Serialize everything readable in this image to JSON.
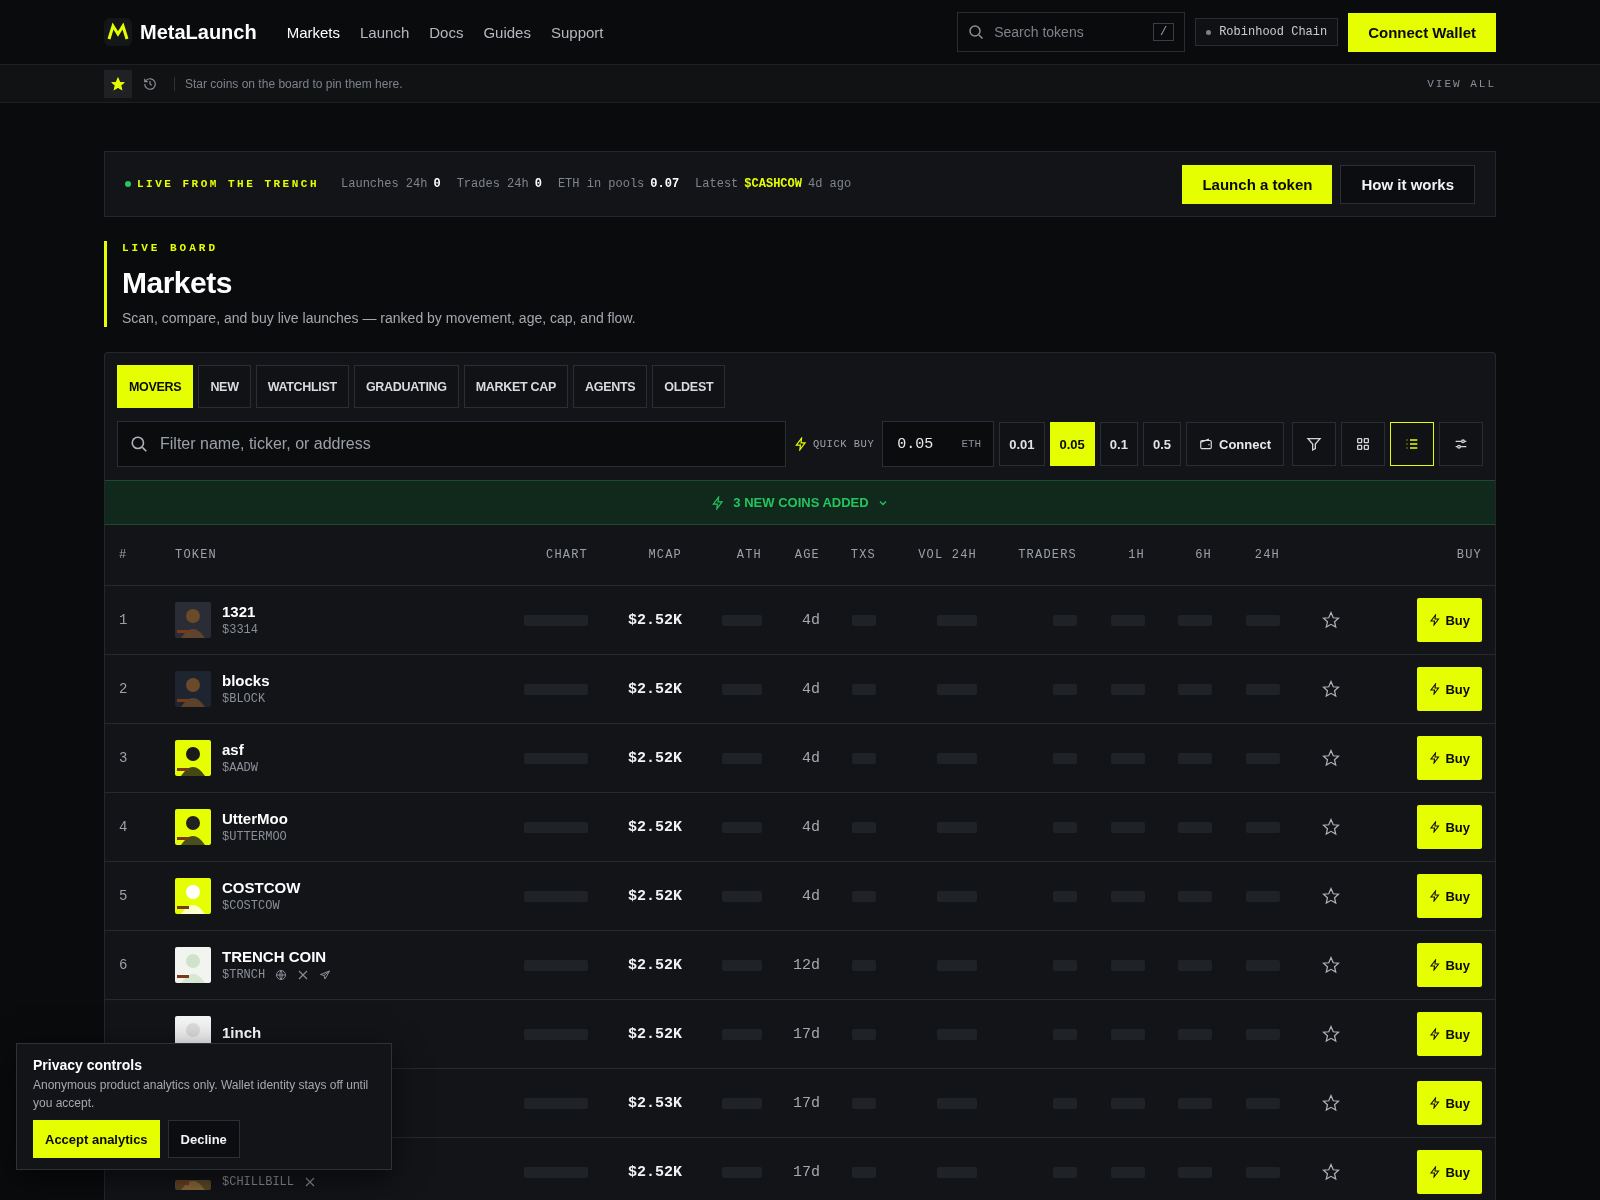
{
  "nav": {
    "brand": "MetaLaunch",
    "links": [
      {
        "label": "Markets",
        "selected": true
      },
      {
        "label": "Launch",
        "selected": false
      },
      {
        "label": "Docs",
        "selected": false
      },
      {
        "label": "Guides",
        "selected": false
      },
      {
        "label": "Support",
        "selected": false
      }
    ],
    "search": {
      "placeholder": "Search tokens",
      "shortcut": "/"
    },
    "chain": "Robinhood Chain",
    "connect": "Connect Wallet"
  },
  "pinbar": {
    "tabs": [
      {
        "kind": "starred",
        "selected": true
      },
      {
        "kind": "recent",
        "selected": false
      }
    ],
    "hint": "Star coins on the board to pin them here.",
    "view_all": "VIEW ALL"
  },
  "ticker": {
    "live": "LIVE FROM THE TRENCH",
    "stats": [
      {
        "label": "Launches 24h",
        "value": "0"
      },
      {
        "label": "Trades 24h",
        "value": "0"
      },
      {
        "label": "ETH in pools",
        "value": "0.07"
      }
    ],
    "latest": {
      "label": "Latest",
      "ticker": "$CASHCOW",
      "age": "4d ago"
    },
    "buttons": [
      {
        "label": "Launch a token",
        "kind": "primary"
      },
      {
        "label": "How it works",
        "kind": "secondary"
      }
    ]
  },
  "board": {
    "eyebrow": "LIVE BOARD",
    "title": "Markets",
    "subtitle": "Scan, compare, and buy live launches — ranked by movement, age, cap, and flow."
  },
  "tabs": [
    {
      "label": "MOVERS",
      "selected": true
    },
    {
      "label": "NEW",
      "selected": false
    },
    {
      "label": "WATCHLIST",
      "selected": false
    },
    {
      "label": "GRADUATING",
      "selected": false
    },
    {
      "label": "MARKET CAP",
      "selected": false
    },
    {
      "label": "AGENTS",
      "selected": false
    },
    {
      "label": "OLDEST",
      "selected": false
    }
  ],
  "filter": {
    "placeholder": "Filter name, ticker, or address"
  },
  "quick_buy": {
    "label": "QUICK BUY",
    "amount": "0.05",
    "unit": "ETH",
    "presets": [
      {
        "label": "0.01",
        "selected": false
      },
      {
        "label": "0.05",
        "selected": true
      },
      {
        "label": "0.1",
        "selected": false
      },
      {
        "label": "0.5",
        "selected": false
      }
    ],
    "connect": "Connect"
  },
  "views": [
    {
      "kind": "filter",
      "selected": false
    },
    {
      "kind": "grid",
      "selected": false
    },
    {
      "kind": "list",
      "selected": true
    },
    {
      "kind": "settings",
      "selected": false
    }
  ],
  "banner": "3 NEW COINS ADDED",
  "table": {
    "columns": [
      "#",
      "TOKEN",
      "CHART",
      "MCAP",
      "ATH",
      "AGE",
      "TXS",
      "VOL 24H",
      "TRADERS",
      "1H",
      "6H",
      "24H",
      "BUY"
    ],
    "rows": [
      {
        "rank": "1",
        "name": "1321",
        "ticker": "$3314",
        "web": false,
        "x": false,
        "telegram": false,
        "mcap": "$2.52K",
        "age": "4d",
        "starred": false,
        "buy": "Buy"
      },
      {
        "rank": "2",
        "name": "blocks",
        "ticker": "$BLOCK",
        "web": false,
        "x": false,
        "telegram": false,
        "mcap": "$2.52K",
        "age": "4d",
        "starred": false,
        "buy": "Buy"
      },
      {
        "rank": "3",
        "name": "asf",
        "ticker": "$AADW",
        "web": false,
        "x": false,
        "telegram": false,
        "mcap": "$2.52K",
        "age": "4d",
        "starred": false,
        "buy": "Buy"
      },
      {
        "rank": "4",
        "name": "UtterMoo",
        "ticker": "$UTTERMOO",
        "web": false,
        "x": false,
        "telegram": false,
        "mcap": "$2.52K",
        "age": "4d",
        "starred": false,
        "buy": "Buy"
      },
      {
        "rank": "5",
        "name": "COSTCOW",
        "ticker": "$COSTCOW",
        "web": false,
        "x": false,
        "telegram": false,
        "mcap": "$2.52K",
        "age": "4d",
        "starred": false,
        "buy": "Buy"
      },
      {
        "rank": "6",
        "name": "TRENCH COIN",
        "ticker": "$TRNCH",
        "web": true,
        "x": true,
        "telegram": true,
        "mcap": "$2.52K",
        "age": "12d",
        "starred": false,
        "buy": "Buy"
      },
      {
        "name": "1inch",
        "web": false,
        "x": false,
        "telegram": false,
        "mcap": "$2.52K",
        "age": "17d",
        "starred": false,
        "buy": "Buy"
      },
      {
        "web": false,
        "x": false,
        "telegram": false,
        "mcap": "$2.53K",
        "age": "17d",
        "starred": false,
        "buy": "Buy"
      },
      {
        "ticker": "$CHILLBILL",
        "web": false,
        "x": true,
        "telegram": false,
        "mcap": "$2.52K",
        "age": "17d",
        "starred": false,
        "buy": "Buy"
      }
    ]
  },
  "privacy": {
    "title": "Privacy controls",
    "text": "Anonymous product analytics only. Wallet identity stays off until you accept.",
    "accept": "Accept analytics",
    "decline": "Decline"
  }
}
